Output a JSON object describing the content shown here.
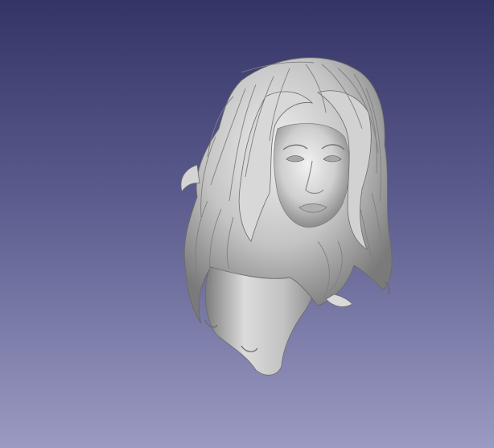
{
  "viewer": {
    "background_top": "#343466",
    "background_bottom": "#9a9ac2"
  },
  "model": {
    "shading_color": "#c8c8c8",
    "highlight_color": "#eeeeee",
    "shadow_color": "#6e6e6e"
  }
}
